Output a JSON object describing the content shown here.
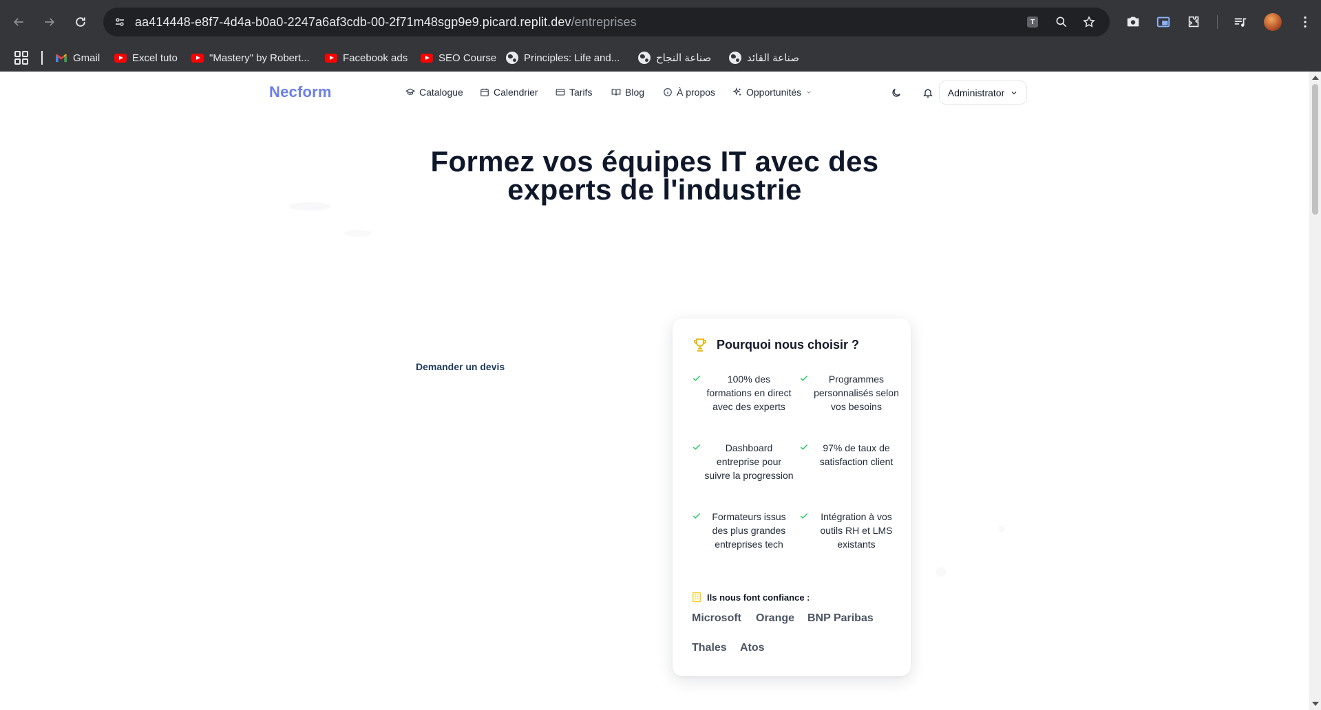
{
  "browser": {
    "url_host": "aa414448-e8f7-4d4a-b0a0-2247a6af3cdb-00-2f71m48sgp9e9.picard.replit.dev",
    "url_path": "/entreprises",
    "translate_badge": "T"
  },
  "bookmarks": [
    {
      "label": "Gmail",
      "icon": "gmail-icon"
    },
    {
      "label": "Excel tuto",
      "icon": "youtube-icon"
    },
    {
      "label": "\"Mastery\" by Robert...",
      "icon": "youtube-icon"
    },
    {
      "label": "Facebook ads",
      "icon": "youtube-icon"
    },
    {
      "label": "SEO Course",
      "icon": "youtube-icon"
    },
    {
      "label": "Principles: Life and...",
      "icon": "globe-icon"
    },
    {
      "label": "صناعة النجاح",
      "icon": "globe-icon"
    },
    {
      "label": "صناعة القائد",
      "icon": "globe-icon"
    }
  ],
  "site": {
    "logo": "Necform",
    "nav": [
      {
        "label": "Catalogue",
        "icon": "graduation-cap-icon"
      },
      {
        "label": "Calendrier",
        "icon": "calendar-icon"
      },
      {
        "label": "Tarifs",
        "icon": "credit-card-icon"
      },
      {
        "label": "Blog",
        "icon": "book-open-icon"
      },
      {
        "label": "À propos",
        "icon": "info-icon"
      },
      {
        "label": "Opportunités",
        "icon": "sparkles-icon",
        "dropdown": true
      }
    ],
    "user_menu_label": "Administrator"
  },
  "hero": {
    "title_line1": "Formez vos équipes IT avec des",
    "title_line2": "experts de l'industrie",
    "cta_label": "Demander un devis"
  },
  "why_card": {
    "title": "Pourquoi nous choisir ?",
    "features": [
      "100% des formations en direct avec des experts",
      "Programmes personnalisés selon vos besoins",
      "Dashboard entreprise pour suivre la progression",
      "97% de taux de satisfaction client",
      "Formateurs issus des plus grandes entreprises tech",
      "Intégration à vos outils RH et LMS existants"
    ],
    "trust_label": "Ils nous font confiance :",
    "clients": [
      "Microsoft",
      "Orange",
      "BNP Paribas",
      "Thales",
      "Atos"
    ]
  },
  "colors": {
    "chrome_bg": "#35363a",
    "omnibox_bg": "#202124",
    "logo_accent": "#6b7fe8",
    "heading": "#0f172a",
    "check_green": "#22c55e",
    "trophy_gold": "#eab308"
  }
}
